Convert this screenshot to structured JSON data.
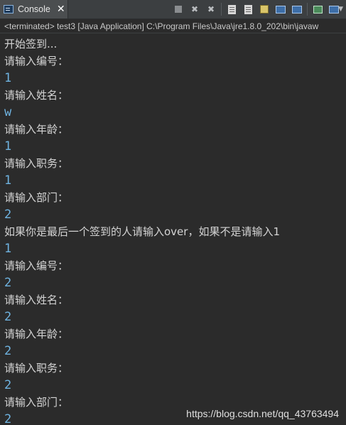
{
  "tab": {
    "label": "Console",
    "close": "✕"
  },
  "toolbar": {
    "buttons": [
      "terminate-icon",
      "remove-launch-icon",
      "remove-all-icon",
      "scroll-lock-icon",
      "word-wrap-icon",
      "show-out-icon",
      "show-err-icon",
      "pin-console-icon",
      "display-console-icon",
      "new-console-icon"
    ]
  },
  "status": {
    "text": "<terminated> test3 [Java Application] C:\\Program Files\\Java\\jre1.8.0_202\\bin\\javaw"
  },
  "console": {
    "lines": [
      {
        "text": "开始签到...",
        "type": "out"
      },
      {
        "text": "请输入编号：",
        "type": "out"
      },
      {
        "text": "1",
        "type": "in"
      },
      {
        "text": "请输入姓名：",
        "type": "out"
      },
      {
        "text": "w",
        "type": "in"
      },
      {
        "text": "请输入年龄：",
        "type": "out"
      },
      {
        "text": "1",
        "type": "in"
      },
      {
        "text": "请输入职务：",
        "type": "out"
      },
      {
        "text": "1",
        "type": "in"
      },
      {
        "text": "请输入部门：",
        "type": "out"
      },
      {
        "text": "2",
        "type": "in"
      },
      {
        "text": "如果你是最后一个签到的人请输入over，如果不是请输入1",
        "type": "out"
      },
      {
        "text": "1",
        "type": "in"
      },
      {
        "text": "请输入编号：",
        "type": "out"
      },
      {
        "text": "2",
        "type": "in"
      },
      {
        "text": "请输入姓名：",
        "type": "out"
      },
      {
        "text": "2",
        "type": "in"
      },
      {
        "text": "请输入年龄：",
        "type": "out"
      },
      {
        "text": "2",
        "type": "in"
      },
      {
        "text": "请输入职务：",
        "type": "out"
      },
      {
        "text": "2",
        "type": "in"
      },
      {
        "text": "请输入部门：",
        "type": "out"
      },
      {
        "text": "2",
        "type": "in"
      }
    ]
  },
  "watermark": "https://blog.csdn.net/qq_43763494",
  "colors": {
    "background": "#2b2b2b",
    "output": "#d4d4d4",
    "input": "#6fb3e0"
  }
}
